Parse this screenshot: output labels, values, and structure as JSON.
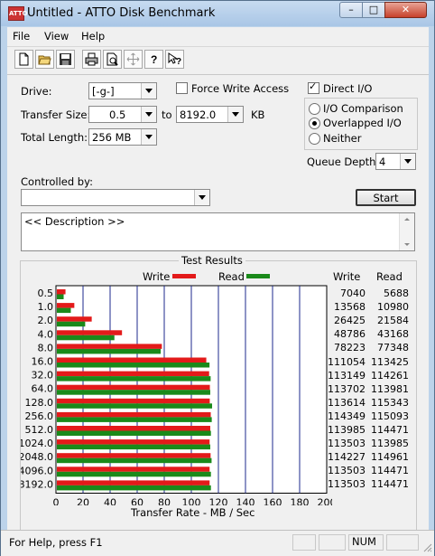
{
  "window": {
    "title": "Untitled - ATTO Disk Benchmark",
    "app_icon_text": "ATTO",
    "minimize": "–",
    "maximize": "□",
    "close": "✕"
  },
  "menu": [
    "File",
    "View",
    "Help"
  ],
  "toolbar_icons": [
    "new-file-icon",
    "open-folder-icon",
    "save-icon",
    "print-icon",
    "print-preview-icon",
    "move-icon",
    "help-icon",
    "context-help-icon"
  ],
  "settings": {
    "drive_label": "Drive:",
    "drive_value": "[-g-]",
    "force_write_label": "Force Write Access",
    "force_write_checked": false,
    "direct_io_label": "Direct I/O",
    "direct_io_checked": true,
    "transfer_size_label": "Transfer Size:",
    "transfer_from": "0.5",
    "to_label": "to",
    "transfer_to": "8192.0",
    "kb_label": "KB",
    "total_length_label": "Total Length:",
    "total_length_value": "256 MB",
    "io_options": [
      {
        "label": "I/O Comparison",
        "selected": false
      },
      {
        "label": "Overlapped I/O",
        "selected": true
      },
      {
        "label": "Neither",
        "selected": false
      }
    ],
    "queue_depth_label": "Queue Depth:",
    "queue_depth_value": "4",
    "controlled_by_label": "Controlled by:",
    "controlled_by_value": "",
    "start_label": "Start",
    "description": "<< Description >>"
  },
  "results": {
    "title": "Test Results",
    "write_legend": "Write",
    "read_legend": "Read",
    "write_col": "Write",
    "read_col": "Read",
    "xlabel": "Transfer Rate - MB / Sec",
    "write_color": "#e31a1a",
    "read_color": "#1a8a1a"
  },
  "chart_data": {
    "type": "bar",
    "orientation": "horizontal",
    "categories": [
      "0.5",
      "1.0",
      "2.0",
      "4.0",
      "8.0",
      "16.0",
      "32.0",
      "64.0",
      "128.0",
      "256.0",
      "512.0",
      "1024.0",
      "2048.0",
      "4096.0",
      "8192.0"
    ],
    "series": [
      {
        "name": "Write",
        "values": [
          7040,
          13568,
          26425,
          48786,
          78223,
          111054,
          113149,
          113702,
          113614,
          114349,
          113985,
          113503,
          114227,
          113503,
          113503
        ]
      },
      {
        "name": "Read",
        "values": [
          5688,
          10980,
          21584,
          43168,
          77348,
          113425,
          114261,
          113981,
          115343,
          115093,
          114471,
          113985,
          114961,
          114471,
          114471
        ]
      }
    ],
    "xlabel": "Transfer Rate - MB / Sec",
    "xticks": [
      "0",
      "20",
      "40",
      "60",
      "80",
      "100",
      "120",
      "140",
      "160",
      "180",
      "200"
    ],
    "xlim": [
      0,
      200
    ],
    "grid": true
  },
  "status": {
    "help_text": "For Help, press F1",
    "num": "NUM"
  }
}
